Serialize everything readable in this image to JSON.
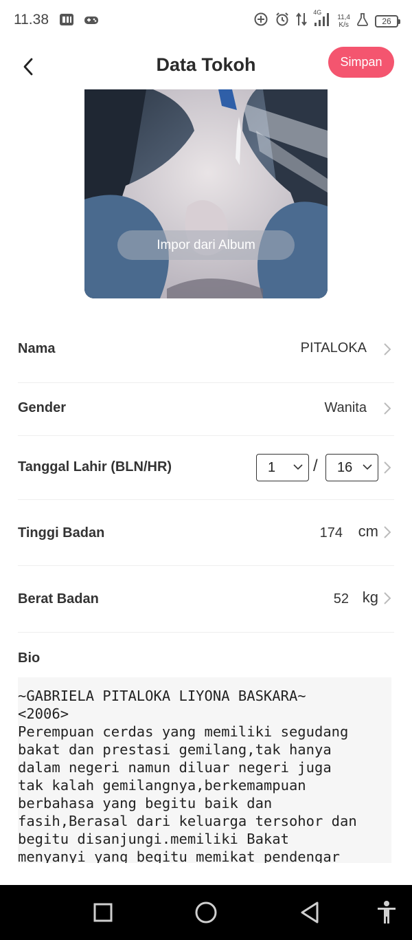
{
  "status_bar": {
    "time": "11.38",
    "net_speed_value": "11,4",
    "net_speed_unit": "K/s",
    "network_type": "4G",
    "battery_level": "26"
  },
  "header": {
    "title": "Data Tokoh",
    "save_label": "Simpan"
  },
  "avatar": {
    "import_label": "Impor dari Album"
  },
  "form": {
    "name": {
      "label": "Nama",
      "value": "PITALOKA"
    },
    "gender": {
      "label": "Gender",
      "value": "Wanita"
    },
    "birthdate": {
      "label": "Tanggal Lahir (BLN/HR)",
      "month": "1",
      "separator": "/",
      "day": "16"
    },
    "height": {
      "label": "Tinggi Badan",
      "value": "174",
      "unit": "cm"
    },
    "weight": {
      "label": "Berat Badan",
      "value": "52",
      "unit": "kg"
    }
  },
  "bio": {
    "label": "Bio",
    "text": "~GABRIELA PITALOKA LIYONA BASKARA~\n<2006>\nPerempuan cerdas yang memiliki segudang\nbakat dan prestasi gemilang,tak hanya\ndalam negeri namun diluar negeri juga\ntak kalah gemilangnya,berkemampuan\nberbahasa yang begitu baik dan\nfasih,Berasal dari keluarga tersohor dan\nbegitu disanjungi.memiliki Bakat\nmenyanyi yang begitu memikat pendengar"
  },
  "colors": {
    "accent": "#f4556f",
    "nav_bar": "#000000"
  }
}
